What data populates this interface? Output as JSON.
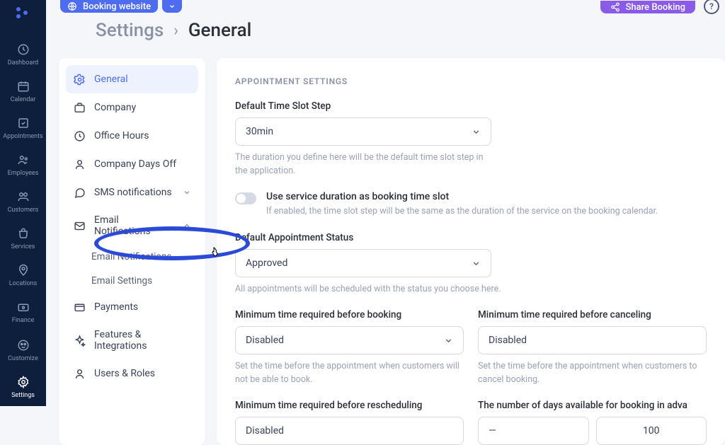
{
  "topbar": {
    "booking_label": "Booking website",
    "share_label": "Share Booking"
  },
  "nav": {
    "items": [
      {
        "label": "Dashboard"
      },
      {
        "label": "Calendar"
      },
      {
        "label": "Appointments"
      },
      {
        "label": "Employees"
      },
      {
        "label": "Customers"
      },
      {
        "label": "Services"
      },
      {
        "label": "Locations"
      },
      {
        "label": "Finance"
      }
    ],
    "bottom": [
      {
        "label": "Customize"
      },
      {
        "label": "Settings"
      }
    ]
  },
  "breadcrumb": {
    "parent": "Settings",
    "current": "General"
  },
  "settings_menu": {
    "items": [
      {
        "label": "General"
      },
      {
        "label": "Company"
      },
      {
        "label": "Office Hours"
      },
      {
        "label": "Company Days Off"
      },
      {
        "label": "SMS notifications"
      },
      {
        "label": "Email Notifications"
      },
      {
        "label": "Payments"
      },
      {
        "label": "Features & Integrations"
      },
      {
        "label": "Users & Roles"
      }
    ],
    "email_sub": [
      {
        "label": "Email Notifications"
      },
      {
        "label": "Email Settings"
      }
    ]
  },
  "form": {
    "section_title": "APPOINTMENT SETTINGS",
    "timeslot": {
      "label": "Default Time Slot Step",
      "value": "30min",
      "help": "The duration you define here will be the default time slot step in the application."
    },
    "service_duration": {
      "label": "Use service duration as booking time slot",
      "help": "If enabled, the time slot step will be the same as the duration of the service on the booking calendar."
    },
    "status": {
      "label": "Default Appointment Status",
      "value": "Approved",
      "help": "All appointments will be scheduled with the status you choose here."
    },
    "min_booking": {
      "label": "Minimum time required before booking",
      "value": "Disabled",
      "help": "Set the time before the appointment when customers will not be able to book."
    },
    "min_cancel": {
      "label": "Minimum time required before canceling",
      "value": "Disabled",
      "help": "Set the time before the appointment when customers to cancel booking."
    },
    "min_resched": {
      "label": "Minimum time required before rescheduling",
      "value": "Disabled"
    },
    "days_avail": {
      "label": "The number of days available for booking in adva",
      "value": "—",
      "value2": "100"
    }
  }
}
